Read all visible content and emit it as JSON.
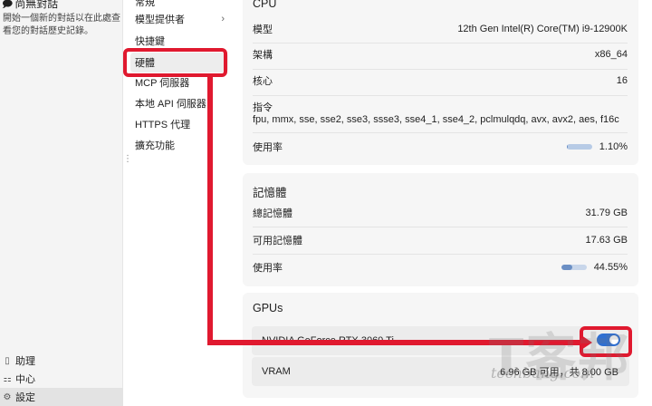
{
  "sidebar": {
    "top_title": "尚無對話",
    "hint": "開始一個新的對話以在此處查看您的對話歷史記錄。",
    "bottom_items": [
      {
        "label": "助理",
        "icon": "book-icon"
      },
      {
        "label": "中心",
        "icon": "hub-icon"
      },
      {
        "label": "設定",
        "icon": "gear-icon"
      }
    ]
  },
  "nav": {
    "clipped_top": "常規",
    "items": [
      {
        "label": "模型提供者",
        "has_chevron": true
      },
      {
        "label": "快捷鍵"
      },
      {
        "label": "硬體",
        "active": true
      },
      {
        "label": "MCP 伺服器"
      },
      {
        "label": "本地 API 伺服器"
      },
      {
        "label": "HTTPS 代理"
      },
      {
        "label": "擴充功能"
      }
    ],
    "chevron": "›"
  },
  "cpu": {
    "title": "CPU",
    "model_label": "模型",
    "model_value": "12th Gen Intel(R) Core(TM) i9-12900K",
    "arch_label": "架構",
    "arch_value": "x86_64",
    "cores_label": "核心",
    "cores_value": "16",
    "instr_label": "指令",
    "instr_value": "fpu, mmx, sse, sse2, sse3, ssse3, sse4_1, sse4_2, pclmulqdq, avx, avx2, aes, f16c",
    "usage_label": "使用率",
    "usage_value": "1.10%",
    "usage_fraction": 0.011
  },
  "memory": {
    "title": "記憶體",
    "total_label": "總記憶體",
    "total_value": "31.79 GB",
    "avail_label": "可用記憶體",
    "avail_value": "17.63 GB",
    "usage_label": "使用率",
    "usage_value": "44.55%",
    "usage_fraction": 0.4455
  },
  "gpus": {
    "title": "GPUs",
    "gpu_name": "NVIDIA GeForce RTX 3060 Ti",
    "gpu_enabled": true,
    "vram_label": "VRAM",
    "vram_value": "6.96 GB 可用，共 8.00 GB"
  },
  "watermark": {
    "big": "T客邦",
    "small": "techbang.com"
  },
  "colors": {
    "annotation": "#e0192f",
    "toggle_on": "#2f6fd1",
    "bar_fill": "#6b8fc4"
  }
}
